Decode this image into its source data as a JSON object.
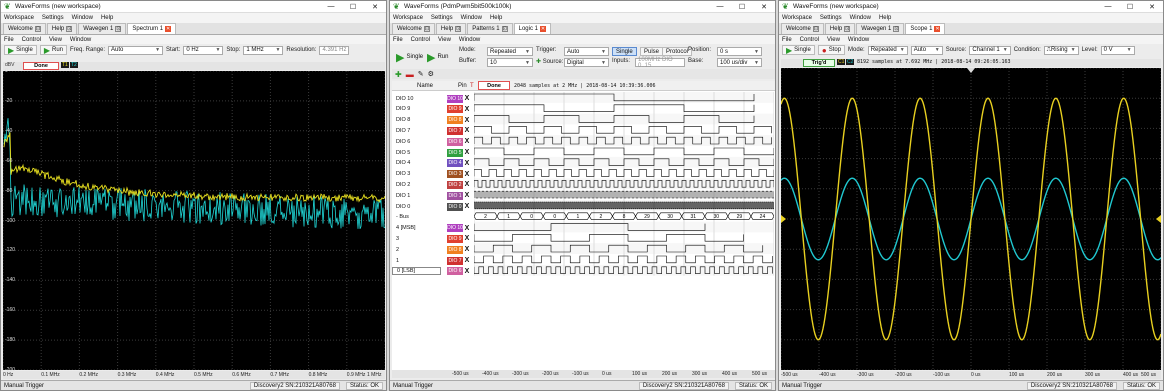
{
  "window_controls": {
    "minimize": "—",
    "maximize": "☐",
    "close": "✕"
  },
  "spectrum_window": {
    "title": "WaveForms  (new workspace)",
    "menu": [
      "Workspace",
      "Settings",
      "Window",
      "Help"
    ],
    "tabs": [
      {
        "label": "Welcome"
      },
      {
        "label": "Help"
      },
      {
        "label": "Wavegen 1"
      },
      {
        "label": "Spectrum 1"
      }
    ],
    "submenu": [
      "File",
      "Control",
      "View",
      "Window"
    ],
    "single_label": "Single",
    "run_label": "Run",
    "freq_range_label": "Freq. Range:",
    "freq_range_value": "Auto",
    "start_label": "Start:",
    "start_value": "0 Hz",
    "stop_label": "Stop:",
    "stop_value": "1 MHz",
    "resolution_label": "Resolution:",
    "resolution_value": "4.391 Hz",
    "status_text": "Done",
    "trace1": "T1",
    "trace2": "T2",
    "unit_label": "dBV",
    "y_ticks": [
      "0",
      "-20",
      "-40",
      "-60",
      "-80",
      "-100",
      "-120",
      "-140",
      "-160",
      "-180",
      "-200"
    ],
    "x_ticks": [
      "0 Hz",
      "0.1 MHz",
      "0.2 MHz",
      "0.3 MHz",
      "0.4 MHz",
      "0.5 MHz",
      "0.6 MHz",
      "0.7 MHz",
      "0.8 MHz",
      "0.9 MHz",
      "1 MHz"
    ],
    "manual_trigger": "Manual Trigger",
    "device": "Discovery2 SN:210321A80768",
    "status": "Status: OK",
    "colors": {
      "trace1": "#e8e020",
      "trace2": "#20d8d8"
    }
  },
  "logic_window": {
    "title": "WaveForms  (PdmPwm5bit500k100k)",
    "menu": [
      "Workspace",
      "Settings",
      "Window",
      "Help"
    ],
    "tabs": [
      {
        "label": "Welcome"
      },
      {
        "label": "Help"
      },
      {
        "label": "Patterns 1"
      },
      {
        "label": "Logic 1"
      }
    ],
    "submenu": [
      "File",
      "Control",
      "View",
      "Window"
    ],
    "single_label": "Single",
    "run_label": "Run",
    "mode_label": "Mode:",
    "mode_value": "Repeated",
    "buffer_label": "Buffer:",
    "buffer_value": "10",
    "trigger_label": "Trigger:",
    "trigger_value": "Auto",
    "source_label": "Source:",
    "source_value": "Digital",
    "btn_single": "Single",
    "btn_pulse": "Pulse",
    "btn_protocol": "Protocol",
    "inputs_label": "Inputs:",
    "inputs_value": "100MHz DIO 0..15",
    "position_label": "Position:",
    "position_value": "0 s",
    "base_label": "Base:",
    "base_value": "100 us/div",
    "header_name": "Name",
    "header_pin": "Pin",
    "header_t": "T",
    "status_text": "Done",
    "samples_text": "2048 samples at 2 MHz | 2018-08-14 10:39:36.006",
    "signals": [
      {
        "name": "DIO 10",
        "pin": "DIO 10"
      },
      {
        "name": "DIO 9",
        "pin": "DIO 9"
      },
      {
        "name": "DIO 8",
        "pin": "DIO 8"
      },
      {
        "name": "DIO 7",
        "pin": "DIO 7"
      },
      {
        "name": "DIO 6",
        "pin": "DIO 6"
      },
      {
        "name": "DIO 5",
        "pin": "DIO 5"
      },
      {
        "name": "DIO 4",
        "pin": "DIO 4"
      },
      {
        "name": "DIO 3",
        "pin": "DIO 3"
      },
      {
        "name": "DIO 2",
        "pin": "DIO 2"
      },
      {
        "name": "DIO 1",
        "pin": "DIO 1"
      },
      {
        "name": "DIO 0",
        "pin": "DIO 0"
      },
      {
        "name": "- Bus",
        "pin": ""
      },
      {
        "name": "4 [MSB]",
        "pin": "DIO 10"
      },
      {
        "name": "3",
        "pin": "DIO 9"
      },
      {
        "name": "2",
        "pin": "DIO 8"
      },
      {
        "name": "1",
        "pin": "DIO 7"
      },
      {
        "name": "0 [LSB]",
        "pin": "DIO 6"
      }
    ],
    "pin_colors": [
      "#b040c0",
      "#e04030",
      "#f08020",
      "#d03030",
      "#d060a0",
      "#30a040",
      "#7050c0",
      "#a05020",
      "#c04040",
      "#a050a0",
      "#505050",
      "",
      "#b040c0",
      "#e04030",
      "#f08020",
      "#d03030",
      "#d060a0"
    ],
    "bus_values": [
      "2",
      "1",
      "0",
      "0",
      "1",
      "2",
      "8",
      "29",
      "30",
      "31",
      "30",
      "29",
      "24"
    ],
    "x_ticks": [
      "-500 us",
      "-400 us",
      "-300 us",
      "-200 us",
      "-100 us",
      "0 us",
      "100 us",
      "200 us",
      "300 us",
      "400 us",
      "500 us"
    ],
    "manual_trigger": "Manual Trigger",
    "device": "Discovery2 SN:210321A80768",
    "status": "Status: OK"
  },
  "scope_window": {
    "title": "WaveForms  (new workspace)",
    "menu": [
      "Workspace",
      "Settings",
      "Window",
      "Help"
    ],
    "tabs": [
      {
        "label": "Welcome"
      },
      {
        "label": "Help"
      },
      {
        "label": "Wavegen 1"
      },
      {
        "label": "Scope 1"
      }
    ],
    "submenu": [
      "File",
      "Control",
      "View",
      "Window"
    ],
    "single_label": "Single",
    "stop_label": "Stop",
    "mode_label": "Mode:",
    "mode_value": "Repeated",
    "trigger_value": "Auto",
    "source_label": "Source:",
    "source_value": "Channel 1",
    "condition_label": "Condition:",
    "condition_value": "Rising",
    "level_label": "Level:",
    "level_value": "0 V",
    "status_text": "Trig'd",
    "ch1": "C1",
    "ch2": "C2",
    "samples_text": "8192 samples at 7.692 MHz | 2018-08-14 09:26:05.163",
    "x_ticks": [
      "-500 us",
      "-400 us",
      "-300 us",
      "-200 us",
      "-100 us",
      "0 us",
      "100 us",
      "200 us",
      "300 us",
      "400 us",
      "500 us"
    ],
    "manual_trigger": "Manual Trigger",
    "device": "Discovery2 SN:210321A80768",
    "status": "Status: OK",
    "colors": {
      "ch1": "#e8d020",
      "ch2": "#20c8d0"
    }
  }
}
